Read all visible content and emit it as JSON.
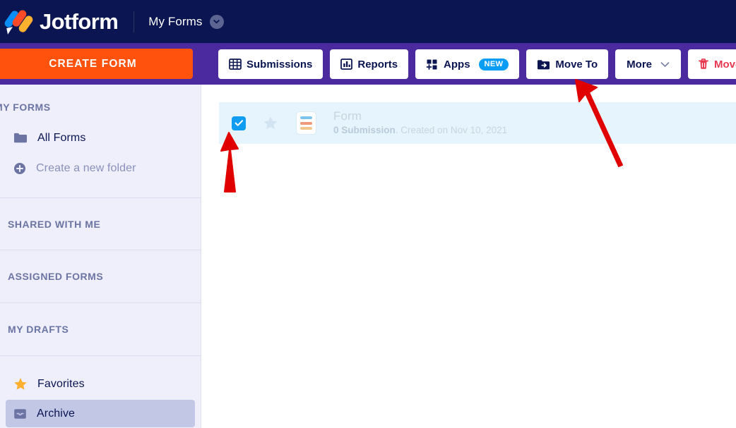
{
  "topnav": {
    "logo_text": "Jotform",
    "logo_icon": "jotform-logo-icon",
    "workspace_label": "My Forms",
    "workspace_chevron_icon": "chevron-down-icon"
  },
  "actionbar": {
    "create_form_label": "CREATE FORM",
    "buttons": [
      {
        "label": "Submissions",
        "icon": "table-grid-icon",
        "badge": ""
      },
      {
        "label": "Reports",
        "icon": "bar-chart-icon",
        "badge": ""
      },
      {
        "label": "Apps",
        "icon": "apps-plus-icon",
        "badge": "NEW"
      },
      {
        "label": "Move To",
        "icon": "folder-arrow-icon",
        "badge": ""
      },
      {
        "label": "More",
        "icon": "chevron-down-icon",
        "badge": ""
      },
      {
        "label": "Move to Trash",
        "icon": "trash-icon",
        "badge": ""
      }
    ]
  },
  "sidebar": {
    "section_my_forms": "MY FORMS",
    "item_all_forms": "All Forms",
    "item_create_folder": "Create a new folder",
    "section_shared_with_me": "SHARED WITH ME",
    "section_assigned_forms": "ASSIGNED FORMS",
    "section_my_drafts": "MY DRAFTS",
    "item_favorites": "Favorites",
    "item_archive": "Archive",
    "icon_folder": "folder-icon",
    "icon_plus": "plus-circle-icon",
    "icon_star": "star-icon",
    "icon_archive": "archive-box-icon"
  },
  "main": {
    "form_row": {
      "title": "Form",
      "submission_count": "0 Submission",
      "created_text": ". Created on Nov 10, 2021",
      "checkbox_checked": "true",
      "checkbox_icon": "checkmark-icon",
      "star_icon": "star-outline-icon",
      "form_icon": "form-document-icon"
    }
  },
  "annotations": {
    "arrow_to_checkbox": "red-arrow-up-icon",
    "arrow_to_more_button": "red-arrow-upleft-icon"
  },
  "colors": {
    "nav_bg": "#0A1551",
    "actionbar_bg": "#4A2A9E",
    "create_form_orange": "#FF520D",
    "sidebar_bg": "#EEEFFA",
    "sidebar_selected": "#C3C7E6",
    "row_bg": "#E6F4FD",
    "checkbox_blue": "#109CF1",
    "trash_red": "#E8384F",
    "badge_blue": "#0A9DF6",
    "annotation_red": "#E00000"
  }
}
